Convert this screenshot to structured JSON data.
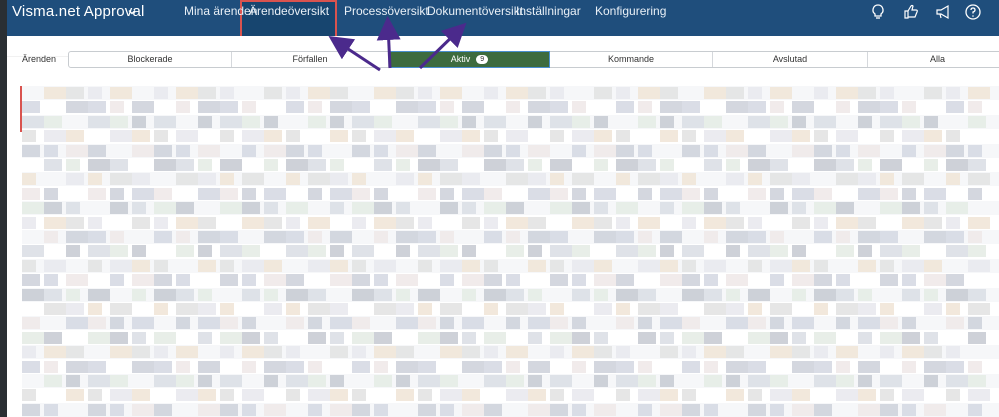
{
  "app": {
    "title": "Visma.net Approval"
  },
  "nav": {
    "items": [
      {
        "label": "Mina ärenden"
      },
      {
        "label": "Ärendeöversikt",
        "active": true
      },
      {
        "label": "Processöversikt"
      },
      {
        "label": "Dokumentöversikt"
      },
      {
        "label": "Inställningar"
      },
      {
        "label": "Konfigurering"
      }
    ],
    "icons": [
      "lightbulb-icon",
      "thumbs-feedback-icon",
      "megaphone-icon",
      "help-icon"
    ]
  },
  "page": {
    "label": "Ärenden"
  },
  "tabs": [
    {
      "label": "Blockerade"
    },
    {
      "label": "Förfallen"
    },
    {
      "label": "Aktiv",
      "count": "9",
      "active": true
    },
    {
      "label": "Kommande"
    },
    {
      "label": "Avslutad"
    },
    {
      "label": "Alla"
    }
  ],
  "colors": {
    "nav_bg": "#1f4e7c",
    "active_tab": "#3d6b3e",
    "highlight": "#d9534f",
    "arrow": "#4b2a8c"
  }
}
